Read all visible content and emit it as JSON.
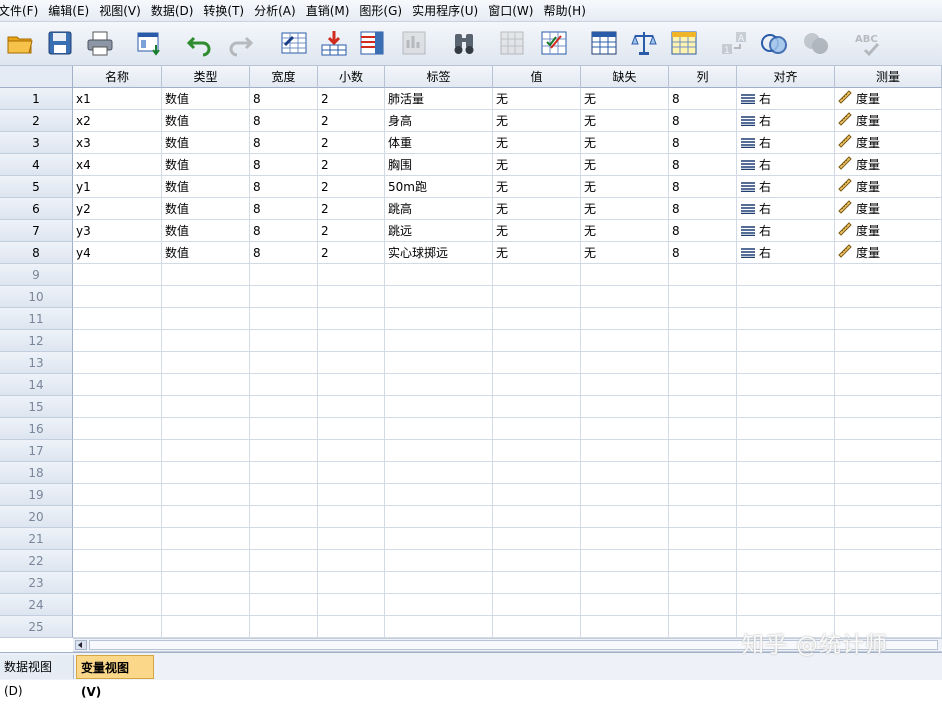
{
  "menu": [
    "文件(F)",
    "编辑(E)",
    "视图(V)",
    "数据(D)",
    "转换(T)",
    "分析(A)",
    "直销(M)",
    "图形(G)",
    "实用程序(U)",
    "窗口(W)",
    "帮助(H)"
  ],
  "toolbar": {
    "icons": [
      "open-folder-icon",
      "save-icon",
      "print-icon",
      "dialog-recall-icon",
      "undo-icon",
      "redo-icon",
      "goto-case-icon",
      "goto-variable-icon",
      "variables-icon",
      "run-descriptives-icon",
      "find-icon",
      "insert-cases-icon",
      "insert-variable-icon",
      "split-file-icon",
      "weight-cases-icon",
      "select-cases-icon",
      "value-labels-icon",
      "use-sets-icon",
      "show-all-variables-icon",
      "spell-check-icon"
    ]
  },
  "columns": [
    "名称",
    "类型",
    "宽度",
    "小数",
    "标签",
    "值",
    "缺失",
    "列",
    "对齐",
    "测量"
  ],
  "rows": [
    {
      "num": "1",
      "name": "x1",
      "type": "数值",
      "width": "8",
      "decimals": "2",
      "label": "肺活量",
      "values": "无",
      "missing": "无",
      "columns": "8",
      "align": "右",
      "measure": "度量"
    },
    {
      "num": "2",
      "name": "x2",
      "type": "数值",
      "width": "8",
      "decimals": "2",
      "label": "身高",
      "values": "无",
      "missing": "无",
      "columns": "8",
      "align": "右",
      "measure": "度量"
    },
    {
      "num": "3",
      "name": "x3",
      "type": "数值",
      "width": "8",
      "decimals": "2",
      "label": "体重",
      "values": "无",
      "missing": "无",
      "columns": "8",
      "align": "右",
      "measure": "度量"
    },
    {
      "num": "4",
      "name": "x4",
      "type": "数值",
      "width": "8",
      "decimals": "2",
      "label": "胸围",
      "values": "无",
      "missing": "无",
      "columns": "8",
      "align": "右",
      "measure": "度量"
    },
    {
      "num": "5",
      "name": "y1",
      "type": "数值",
      "width": "8",
      "decimals": "2",
      "label": "50m跑",
      "values": "无",
      "missing": "无",
      "columns": "8",
      "align": "右",
      "measure": "度量"
    },
    {
      "num": "6",
      "name": "y2",
      "type": "数值",
      "width": "8",
      "decimals": "2",
      "label": "跳高",
      "values": "无",
      "missing": "无",
      "columns": "8",
      "align": "右",
      "measure": "度量"
    },
    {
      "num": "7",
      "name": "y3",
      "type": "数值",
      "width": "8",
      "decimals": "2",
      "label": "跳远",
      "values": "无",
      "missing": "无",
      "columns": "8",
      "align": "右",
      "measure": "度量"
    },
    {
      "num": "8",
      "name": "y4",
      "type": "数值",
      "width": "8",
      "decimals": "2",
      "label": "实心球掷远",
      "values": "无",
      "missing": "无",
      "columns": "8",
      "align": "右",
      "measure": "度量"
    }
  ],
  "empty_rows": [
    "9",
    "10",
    "11",
    "12",
    "13",
    "14",
    "15",
    "16",
    "17",
    "18",
    "19",
    "20",
    "21",
    "22",
    "23",
    "24",
    "25"
  ],
  "tabs": {
    "data_view": "数据视图(D)",
    "variable_view": "变量视图(V)"
  },
  "watermark": "知乎 @统计师",
  "colors": {
    "active_tab": "#fbd78a",
    "header_bg": "#e3e9f2",
    "grid_line": "#d2dae6"
  }
}
